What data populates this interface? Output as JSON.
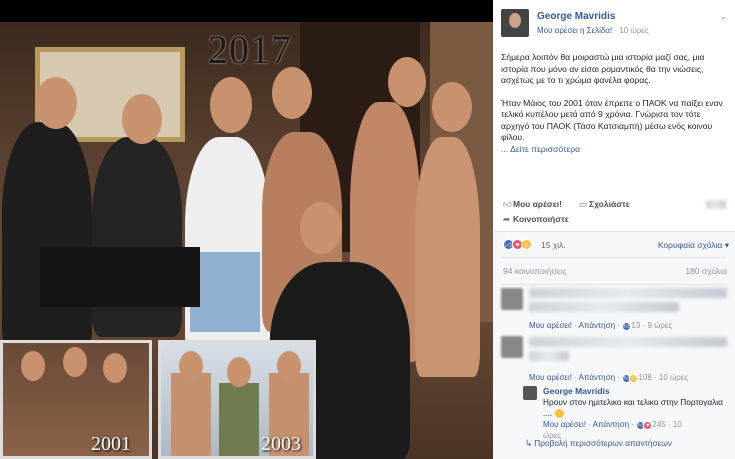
{
  "photo": {
    "year_main": "2017",
    "year_inset_left": "2001",
    "year_inset_right": "2003"
  },
  "post": {
    "author": "George Mavridis",
    "meta_liked_page": "Μου αρέσει η Σελίδα!",
    "meta_separator": "·",
    "meta_time": "10 ώρες",
    "paragraph1": "Σήμερα λοιπόν θα μοιραστώ μια ιστορία μαζί σας, μια ιστορία που μόνο αν είσαι ρομαντικός θα την νιώσεις, ασχέτως με το τι χρώμα φανέλα φορας.",
    "paragraph2": "Ήταν Μάιος του 2001 όταν έπρεπε ο ΠΑΟΚ να παίξει εναν τελικό κυπέλου μετά από 9 χρόνια. Γνώρισα τον τότε αρχηγό του ΠΑΟΚ (Τάσο Κατσιαμπή) μέσω ενός κοινου φίλου.",
    "see_more": "... Δείτε περισσότερα"
  },
  "actions": {
    "like": "Μου αρέσει!",
    "comment": "Σχολιάστε",
    "share": "Κοινοποιήστε"
  },
  "stats": {
    "reactions": "15 χιλ.",
    "sort": "Κορυφαία σχόλια",
    "shares": "94 κοινοποιήσεις",
    "comments": "180 σχόλια"
  },
  "comments": [
    {
      "like": "Μου αρέσει!",
      "reply": "Απάντηση",
      "count": "13",
      "time": "9 ώρες"
    },
    {
      "like": "Μου αρέσει!",
      "reply": "Απάντηση",
      "count": "108",
      "time": "10 ώρες"
    }
  ],
  "reply": {
    "author": "George Mavridis",
    "text": "Ηρουν στον ημιτελικο και τελικο στην Πορτογαλια ....",
    "like": "Μου αρέσει!",
    "reply": "Απάντηση",
    "count": "245",
    "time_num": "10",
    "time_unit": "ώρες"
  },
  "view_more_replies": "Προβολή περισσότερων απαντήσεων",
  "colors": {
    "link": "#365899",
    "grey": "#90949c",
    "like_blue": "#4267b2",
    "love_red": "#f25268",
    "haha_yellow": "#f5c33b"
  }
}
